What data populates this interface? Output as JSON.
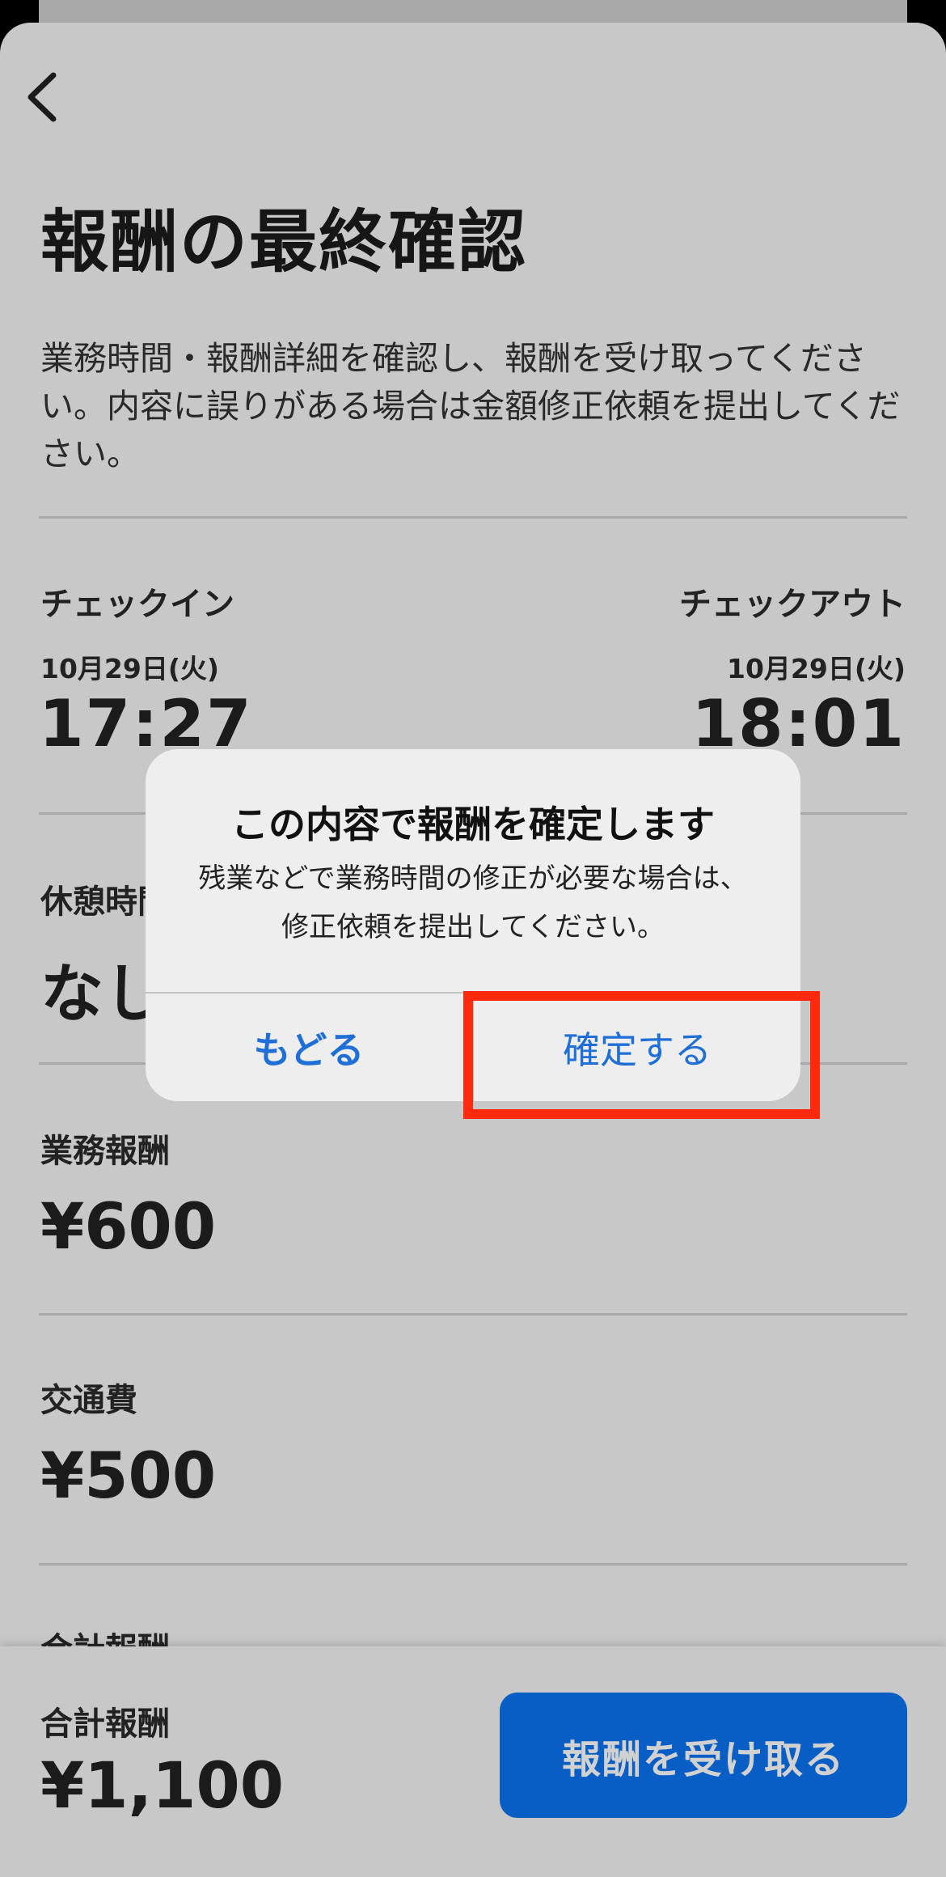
{
  "header": {
    "title": "報酬の最終確認",
    "description": "業務時間・報酬詳細を確認し、報酬を受け取ってください。内容に誤りがある場合は金額修正依頼を提出してください。"
  },
  "checkin": {
    "label": "チェックイン",
    "date": "10月29日(火)",
    "time": "17:27"
  },
  "checkout": {
    "label": "チェックアウト",
    "date": "10月29日(火)",
    "time": "18:01"
  },
  "break": {
    "label": "休憩時間",
    "value": "なし"
  },
  "work_fee": {
    "label": "業務報酬",
    "value": "¥600"
  },
  "transport": {
    "label": "交通費",
    "value": "¥500"
  },
  "total_partial": {
    "label": "合計報酬"
  },
  "bottom": {
    "total_label": "合計報酬",
    "total_value": "¥1,100",
    "receive_button": "報酬を受け取る"
  },
  "dialog": {
    "title": "この内容で報酬を確定します",
    "message_line1": "残業などで業務時間の修正が必要な場合は、",
    "message_line2": "修正依頼を提出してください。",
    "back_button": "もどる",
    "confirm_button": "確定する"
  },
  "colors": {
    "primary_button": "#0a73f0",
    "dialog_button_text": "#1f6fd6",
    "highlight": "#ff2a0e"
  },
  "icons": {
    "back": "chevron-left-icon"
  }
}
